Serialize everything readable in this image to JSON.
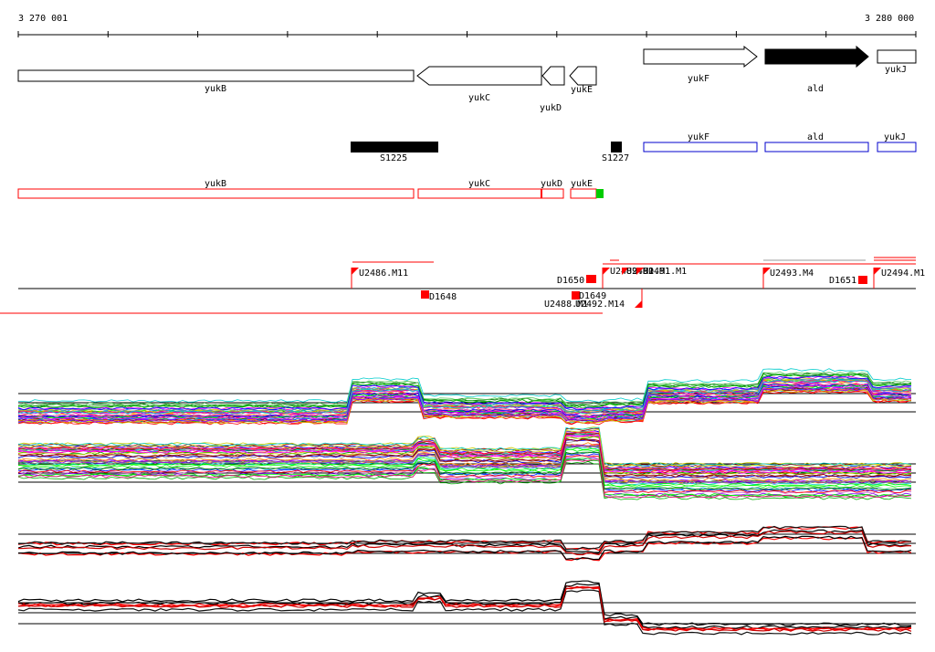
{
  "ruler": {
    "start_label": "3 270 001",
    "end_label": "3 280 000"
  },
  "genes_top": [
    {
      "name": "yukB",
      "strand": "-",
      "fill": "#ffffff"
    },
    {
      "name": "yukC",
      "strand": "-",
      "fill": "#ffffff"
    },
    {
      "name": "yukD",
      "strand": "-",
      "fill": "#ffffff"
    },
    {
      "name": "yukE",
      "strand": "-",
      "fill": "#ffffff"
    },
    {
      "name": "yukF",
      "strand": "+",
      "fill": "#ffffff"
    },
    {
      "name": "ald",
      "strand": "+",
      "fill": "#000000"
    },
    {
      "name": "yukJ",
      "strand": "+",
      "fill": "#ffffff"
    }
  ],
  "blue_genes": [
    {
      "name": "yukF"
    },
    {
      "name": "ald"
    },
    {
      "name": "yukJ"
    }
  ],
  "black_features": [
    {
      "name": "S1225"
    },
    {
      "name": "S1227"
    }
  ],
  "red_genes": [
    {
      "name": "yukB"
    },
    {
      "name": "yukC"
    },
    {
      "name": "yukD"
    },
    {
      "name": "yukE"
    }
  ],
  "transcripts": [
    {
      "name": "U2486.M11"
    },
    {
      "name": "D1648"
    },
    {
      "name": "D1650"
    },
    {
      "name": "D1649"
    },
    {
      "name": "U2488.M1"
    },
    {
      "name": "U2492.M14"
    },
    {
      "name": "U2489.M1"
    },
    {
      "name": "U2490.M1"
    },
    {
      "name": "U2491.M1"
    },
    {
      "name": "U2493.M4"
    },
    {
      "name": "D1651"
    },
    {
      "name": "U2494.M1"
    }
  ],
  "colors": {
    "red": "#ff0000",
    "blue": "#0000cc",
    "green": "#00cc00",
    "black": "#000000"
  }
}
